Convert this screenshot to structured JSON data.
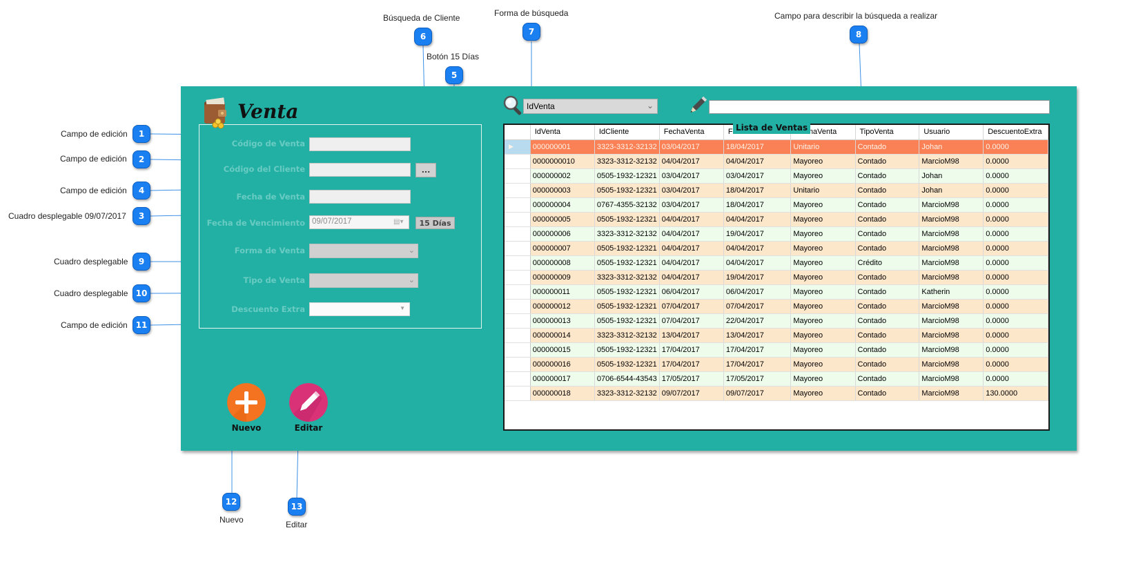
{
  "callouts": {
    "c1": {
      "num": "1",
      "text": "Campo de edición"
    },
    "c2": {
      "num": "2",
      "text": "Campo de edición"
    },
    "c3": {
      "num": "3",
      "text": "Cuadro desplegable 09/07/2017"
    },
    "c4": {
      "num": "4",
      "text": "Campo de edición"
    },
    "c5": {
      "num": "5",
      "text": "Botón 15 Días"
    },
    "c6": {
      "num": "6",
      "text": "Búsqueda de Cliente"
    },
    "c7": {
      "num": "7",
      "text": "Forma de búsqueda"
    },
    "c8": {
      "num": "8",
      "text": "Campo para describir la búsqueda a realizar"
    },
    "c9": {
      "num": "9",
      "text": "Cuadro desplegable"
    },
    "c10": {
      "num": "10",
      "text": "Cuadro desplegable"
    },
    "c11": {
      "num": "11",
      "text": "Campo de edición"
    },
    "c12": {
      "num": "12",
      "text": "Nuevo"
    },
    "c13": {
      "num": "13",
      "text": "Editar"
    }
  },
  "form": {
    "title": "Venta",
    "labels": {
      "codigo_venta": "Código de Venta",
      "codigo_cliente": "Código del Cliente",
      "fecha_venta": "Fecha de Venta",
      "fecha_vencimiento": "Fecha de Vencimiento",
      "forma_venta": "Forma de Venta",
      "tipo_venta": "Tipo de Venta",
      "descuento_extra": "Descuento Extra"
    },
    "values": {
      "fecha_vencimiento": "09/07/2017"
    },
    "buscar_cliente_label": "...",
    "quince_dias_label": "15 Días",
    "nuevo_label": "Nuevo",
    "editar_label": "Editar"
  },
  "search": {
    "mode_value": "IdVenta"
  },
  "grid": {
    "caption": "Lista de Ventas",
    "columns": [
      "IdVenta",
      "IdCliente",
      "FechaVenta",
      "FechaVencimiento",
      "FormaVenta",
      "TipoVenta",
      "Usuario",
      "DescuentoExtra"
    ],
    "rows": [
      [
        "000000001",
        "3323-3312-32132",
        "03/04/2017",
        "18/04/2017",
        "Unitario",
        "Contado",
        "Johan",
        "0.0000"
      ],
      [
        "0000000010",
        "3323-3312-32132",
        "04/04/2017",
        "04/04/2017",
        "Mayoreo",
        "Contado",
        "MarcioM98",
        "0.0000"
      ],
      [
        "000000002",
        "0505-1932-12321",
        "03/04/2017",
        "03/04/2017",
        "Mayoreo",
        "Contado",
        "Johan",
        "0.0000"
      ],
      [
        "000000003",
        "0505-1932-12321",
        "03/04/2017",
        "18/04/2017",
        "Unitario",
        "Contado",
        "Johan",
        "0.0000"
      ],
      [
        "000000004",
        "0767-4355-32132",
        "03/04/2017",
        "18/04/2017",
        "Mayoreo",
        "Contado",
        "MarcioM98",
        "0.0000"
      ],
      [
        "000000005",
        "0505-1932-12321",
        "04/04/2017",
        "04/04/2017",
        "Mayoreo",
        "Contado",
        "MarcioM98",
        "0.0000"
      ],
      [
        "000000006",
        "3323-3312-32132",
        "04/04/2017",
        "19/04/2017",
        "Mayoreo",
        "Contado",
        "MarcioM98",
        "0.0000"
      ],
      [
        "000000007",
        "0505-1932-12321",
        "04/04/2017",
        "04/04/2017",
        "Mayoreo",
        "Contado",
        "MarcioM98",
        "0.0000"
      ],
      [
        "000000008",
        "0505-1932-12321",
        "04/04/2017",
        "04/04/2017",
        "Mayoreo",
        "Crédito",
        "MarcioM98",
        "0.0000"
      ],
      [
        "000000009",
        "3323-3312-32132",
        "04/04/2017",
        "19/04/2017",
        "Mayoreo",
        "Contado",
        "MarcioM98",
        "0.0000"
      ],
      [
        "000000011",
        "0505-1932-12321",
        "06/04/2017",
        "06/04/2017",
        "Mayoreo",
        "Contado",
        "Katherin",
        "0.0000"
      ],
      [
        "000000012",
        "0505-1932-12321",
        "07/04/2017",
        "07/04/2017",
        "Mayoreo",
        "Contado",
        "MarcioM98",
        "0.0000"
      ],
      [
        "000000013",
        "0505-1932-12321",
        "07/04/2017",
        "22/04/2017",
        "Mayoreo",
        "Contado",
        "MarcioM98",
        "0.0000"
      ],
      [
        "000000014",
        "3323-3312-32132",
        "13/04/2017",
        "13/04/2017",
        "Mayoreo",
        "Contado",
        "MarcioM98",
        "0.0000"
      ],
      [
        "000000015",
        "0505-1932-12321",
        "17/04/2017",
        "17/04/2017",
        "Mayoreo",
        "Contado",
        "MarcioM98",
        "0.0000"
      ],
      [
        "000000016",
        "0505-1932-12321",
        "17/04/2017",
        "17/04/2017",
        "Mayoreo",
        "Contado",
        "MarcioM98",
        "0.0000"
      ],
      [
        "000000017",
        "0706-6544-43543",
        "17/05/2017",
        "17/05/2017",
        "Mayoreo",
        "Contado",
        "MarcioM98",
        "0.0000"
      ],
      [
        "000000018",
        "3323-3312-32132",
        "09/07/2017",
        "09/07/2017",
        "Mayoreo",
        "Contado",
        "MarcioM98",
        "130.0000"
      ]
    ]
  },
  "colors": {
    "panel": "#22b0a5",
    "selected_row": "#fa8056",
    "odd_row": "#fde7cb",
    "even_row": "#eefcec",
    "nuevo_button": "#f47320",
    "editar_button": "#d93277",
    "badge": "#1a7ff0"
  },
  "icons": {
    "form": "wallet-icon",
    "search": "magnifier-icon",
    "search_text": "pencil-icon",
    "nuevo": "plus-icon",
    "editar": "pencil-icon"
  }
}
